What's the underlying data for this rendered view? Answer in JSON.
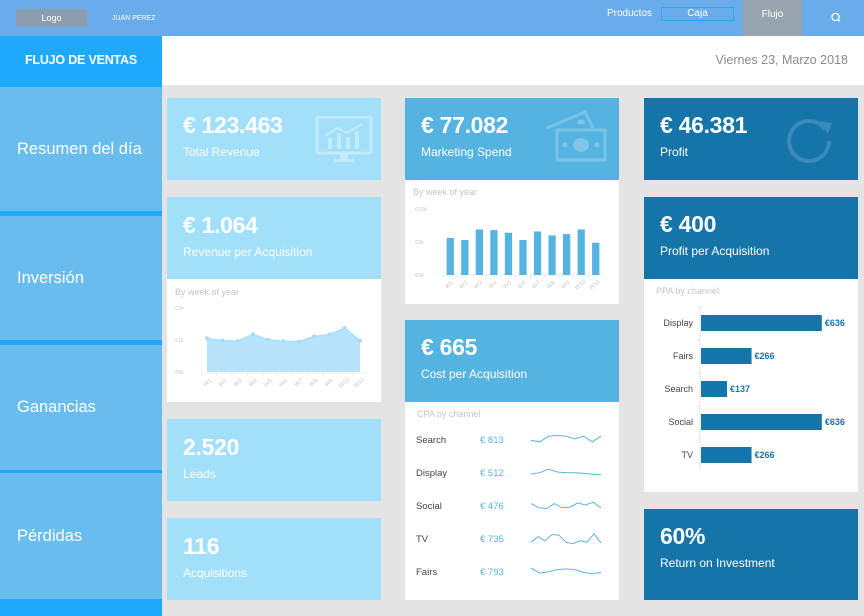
{
  "topbar": {
    "logo_label": "Logo",
    "user_name": "JUAN PEREZ",
    "nav": [
      {
        "label": "Productos",
        "state": "normal"
      },
      {
        "label": "Caja",
        "state": "outlined"
      },
      {
        "label": "Flujo",
        "state": "active"
      }
    ],
    "search_icon": "search-icon"
  },
  "brand": {
    "title": "FLUJO DE VENTAS"
  },
  "header": {
    "date": "Viernes 23, Marzo 2018"
  },
  "sidebar": {
    "items": [
      {
        "label": "Resumen del día"
      },
      {
        "label": "Inversión"
      },
      {
        "label": "Ganancias"
      },
      {
        "label": "Pérdidas"
      }
    ]
  },
  "colors": {
    "topbar": "#6aace9",
    "brand": "#1fa9fd",
    "sidebar_item": "#68bdee",
    "card_light": "#a2dffa",
    "card_mid": "#55b3e2",
    "card_dark": "#1574a8",
    "chart_area": "#b7e4fb",
    "chart_bar": "#55b3e2"
  },
  "kpis": {
    "total_revenue": {
      "value": "€ 123.463",
      "label": "Total Revenue",
      "icon": "monitor-chart-icon"
    },
    "revenue_per_acq": {
      "value": "€ 1.064",
      "label": "Revenue per Acquisition"
    },
    "leads": {
      "value": "2.520",
      "label": "Leads"
    },
    "acquisitions": {
      "value": "116",
      "label": "Acquisitions"
    },
    "marketing_spend": {
      "value": "€ 77.082",
      "label": "Marketing Spend",
      "icon": "money-bills-icon"
    },
    "cost_per_acq": {
      "value": "€ 665",
      "label": "Cost per Acquisition"
    },
    "profit": {
      "value": "€ 46.381",
      "label": "Profit",
      "icon": "refresh-icon"
    },
    "profit_per_acq": {
      "value": "€ 400",
      "label": "Profit per Acquisition"
    },
    "roi": {
      "value": "60%",
      "label": "Return on Investment"
    }
  },
  "chart_data": [
    {
      "id": "revenue_per_acq_chart",
      "type": "area",
      "title": "By week of year",
      "categories": [
        "W1",
        "W2",
        "W3",
        "W4",
        "W5",
        "W6",
        "W7",
        "W8",
        "W9",
        "W10",
        "W11"
      ],
      "values": [
        1.05,
        0.98,
        0.97,
        1.18,
        1.01,
        0.96,
        0.95,
        1.12,
        1.17,
        1.38,
        0.98
      ],
      "yticks": [
        "€0k",
        "€1k",
        "€2k"
      ],
      "ylim": [
        0,
        2
      ],
      "xlabel": "",
      "ylabel": "",
      "grid": false
    },
    {
      "id": "marketing_spend_chart",
      "type": "bar",
      "title": "By week of year",
      "categories": [
        "W1",
        "W2",
        "W3",
        "W4",
        "W5",
        "W6",
        "W7",
        "W8",
        "W9",
        "W10",
        "W11"
      ],
      "values": [
        5.6,
        5.3,
        6.9,
        6.8,
        6.4,
        5.3,
        6.6,
        6.0,
        6.2,
        6.9,
        4.9
      ],
      "yticks": [
        "€0k",
        "€5k",
        "€10k"
      ],
      "ylim": [
        0,
        10
      ],
      "xlabel": "",
      "ylabel": "",
      "grid": false
    },
    {
      "id": "cpa_by_channel",
      "type": "table",
      "title": "CPA by channel",
      "rows": [
        {
          "channel": "Search",
          "value": "€ 813",
          "spark": [
            0.4,
            0.3,
            0.7,
            0.75,
            0.7,
            0.5,
            0.7,
            0.3,
            0.7
          ]
        },
        {
          "channel": "Display",
          "value": "€ 512",
          "spark": [
            0.35,
            0.45,
            0.7,
            0.5,
            0.45,
            0.45,
            0.4,
            0.35,
            0.3
          ]
        },
        {
          "channel": "Social",
          "value": "€ 476",
          "spark": [
            0.6,
            0.3,
            0.25,
            0.6,
            0.3,
            0.35,
            0.65,
            0.5,
            0.7,
            0.3
          ]
        },
        {
          "channel": "TV",
          "value": "€ 735",
          "spark": [
            0.2,
            0.6,
            0.3,
            0.75,
            0.7,
            0.2,
            0.1,
            0.3,
            0.2,
            0.8,
            0.15
          ]
        },
        {
          "channel": "Fairs",
          "value": "€ 793",
          "spark": [
            0.7,
            0.35,
            0.45,
            0.6,
            0.65,
            0.6,
            0.4,
            0.3,
            0.4
          ]
        }
      ]
    },
    {
      "id": "ppa_by_channel",
      "type": "bar",
      "orientation": "horizontal",
      "title": "PPA by channel",
      "categories": [
        "Display",
        "Fairs",
        "Search",
        "Social",
        "TV"
      ],
      "values": [
        636,
        266,
        137,
        636,
        266
      ],
      "data_labels": [
        "€636",
        "€266",
        "€137",
        "€636",
        "€266"
      ],
      "xlim": [
        0,
        700
      ]
    }
  ]
}
